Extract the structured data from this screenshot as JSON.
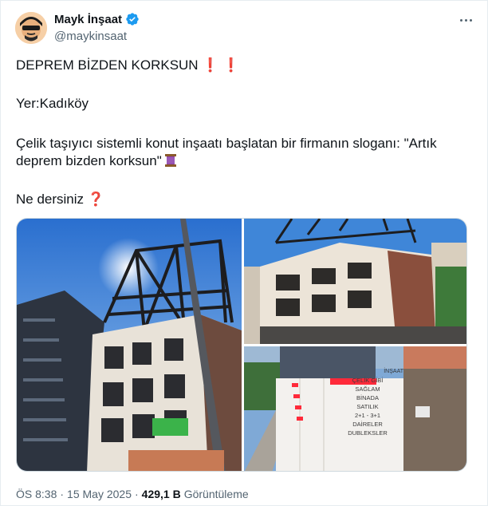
{
  "author": {
    "display_name": "Mayk İnşaat",
    "handle": "@maykinsaat"
  },
  "tweet": {
    "line1": "DEPREM BİZDEN KORKSUN",
    "line1_emoji": "❗ ❗",
    "line2": "Yer:Kadıköy",
    "line3a": "Çelik taşıyıcı sistemli konut inşaatı başlatan bir firmanın sloganı: \"Artık",
    "line3b": "deprem bizden korksun\"",
    "line4": "Ne dersiniz",
    "line4_emoji": "❓"
  },
  "photo_sign": {
    "header": "İNŞAAT",
    "lines": [
      "ÇELİK GİBİ",
      "SAĞLAM",
      "BİNADA",
      "SATILIK",
      "2+1 - 3+1",
      "DAİRELER",
      "DUBLEKSLER"
    ]
  },
  "meta": {
    "time": "ÖS 8:38",
    "dot1": "·",
    "date": "15 May 2025",
    "dot2": "·",
    "views": "429,1 B",
    "views_label": "Görüntüleme"
  },
  "colors": {
    "verified": "#1d9bf0",
    "secondary_text": "#536471",
    "exclamation": "#d1232a"
  },
  "icons": [
    "verified-badge-icon",
    "more-options-icon",
    "exclamation-emoji-icon",
    "thread-spool-emoji-icon",
    "question-emoji-icon"
  ]
}
